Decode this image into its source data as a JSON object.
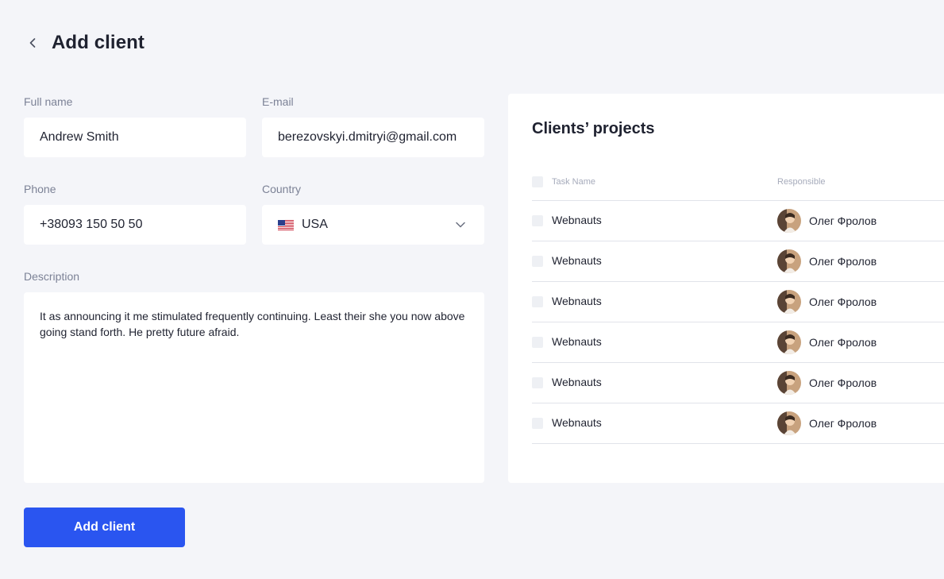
{
  "header": {
    "title": "Add client",
    "back_icon": "chevron-left-icon"
  },
  "form": {
    "full_name": {
      "label": "Full name",
      "value": "Andrew Smith"
    },
    "email": {
      "label": "E-mail",
      "value": "berezovskyi.dmitryi@gmail.com"
    },
    "phone": {
      "label": "Phone",
      "value": "+38093 150 50 50"
    },
    "country": {
      "label": "Country",
      "value": "USA",
      "flag_icon": "us-flag-icon",
      "dropdown_icon": "chevron-down-icon"
    },
    "description": {
      "label": "Description",
      "value": "It as announcing it me stimulated frequently continuing. Least their she you now above going stand forth. He pretty future afraid."
    },
    "submit_label": "Add client"
  },
  "projects": {
    "title": "Clients’ projects",
    "columns": [
      "Task Name",
      "Responsible"
    ],
    "rows": [
      {
        "task": "Webnauts",
        "responsible": "Олег Фролов"
      },
      {
        "task": "Webnauts",
        "responsible": "Олег Фролов"
      },
      {
        "task": "Webnauts",
        "responsible": "Олег Фролов"
      },
      {
        "task": "Webnauts",
        "responsible": "Олег Фролов"
      },
      {
        "task": "Webnauts",
        "responsible": "Олег Фролов"
      },
      {
        "task": "Webnauts",
        "responsible": "Олег Фролов"
      }
    ]
  },
  "colors": {
    "background": "#f4f5f9",
    "primary": "#2a55f0",
    "text": "#1f2230",
    "muted": "#7c8296"
  }
}
